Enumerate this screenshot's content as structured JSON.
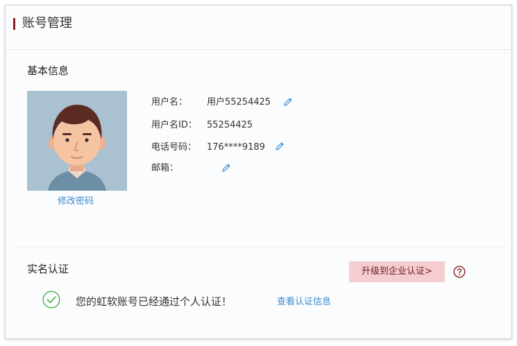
{
  "header": {
    "title": "账号管理"
  },
  "basic_info": {
    "section_title": "基本信息",
    "change_password_label": "修改密码",
    "fields": [
      {
        "label": "用户名：",
        "value": "用户55254425",
        "editable": true
      },
      {
        "label": "用户名ID：",
        "value": "55254425",
        "editable": false
      },
      {
        "label": "电话号码：",
        "value": "176****9189",
        "editable": true
      },
      {
        "label": "邮箱：",
        "value": "",
        "editable": true
      }
    ]
  },
  "realname": {
    "section_title": "实名认证",
    "upgrade_button_label": "升级到企业认证>",
    "help_icon": "question-circle-icon",
    "status_icon": "check-circle-icon",
    "status_text": "您的虹软账号已经通过个人认证！",
    "view_link_label": "查看认证信息"
  },
  "colors": {
    "accent_bar": "#8b1a1a",
    "link": "#3a8ccd",
    "upgrade_bg": "#f5cdd0",
    "upgrade_text": "#6b1a1f",
    "success": "#4caf50",
    "help": "#8b1a1a"
  }
}
